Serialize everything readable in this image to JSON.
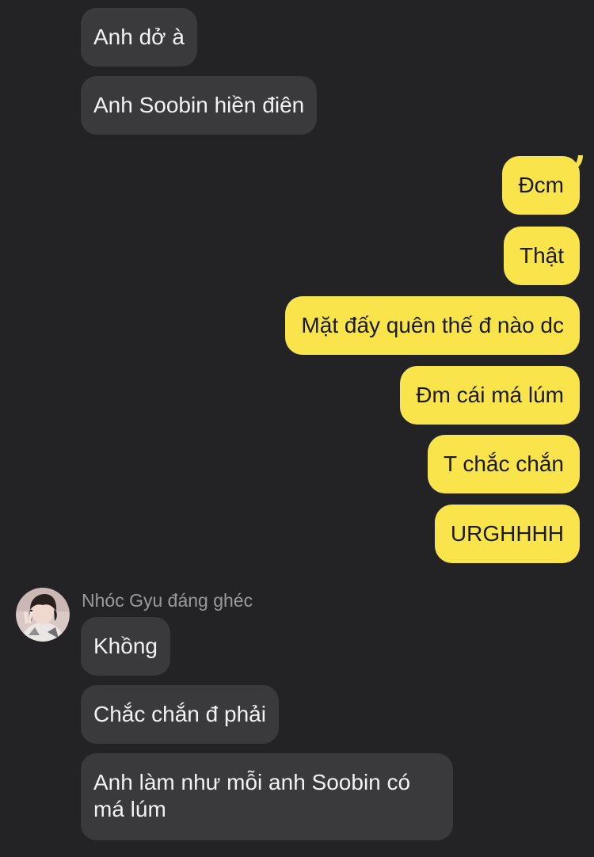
{
  "chat": {
    "incoming_top": [
      {
        "text": "Anh dở à"
      },
      {
        "text": "Anh Soobin hiền điên"
      }
    ],
    "outgoing": [
      {
        "text": "Đcm"
      },
      {
        "text": "Thật"
      },
      {
        "text": "Mặt đấy quên thế đ nào dc"
      },
      {
        "text": "Đm cái má lúm"
      },
      {
        "text": "T chắc chắn"
      },
      {
        "text": "URGHHHH"
      }
    ],
    "sender": {
      "name": "Nhóc Gyu đáng ghéc",
      "avatar_icon": "profile-photo-avatar"
    },
    "incoming_bottom": [
      {
        "text": "Khồng"
      },
      {
        "text": "Chắc chắn đ phải"
      },
      {
        "lines": [
          "Anh làm như mỗi anh Soobin có",
          "má lúm"
        ]
      }
    ],
    "colors": {
      "background": "#232325",
      "incoming_bubble": "#3a3a3c",
      "outgoing_bubble": "#f9e54b",
      "incoming_text": "#f2f2f2",
      "outgoing_text": "#1a1a1a",
      "sender_name": "#9a9a9e"
    }
  }
}
